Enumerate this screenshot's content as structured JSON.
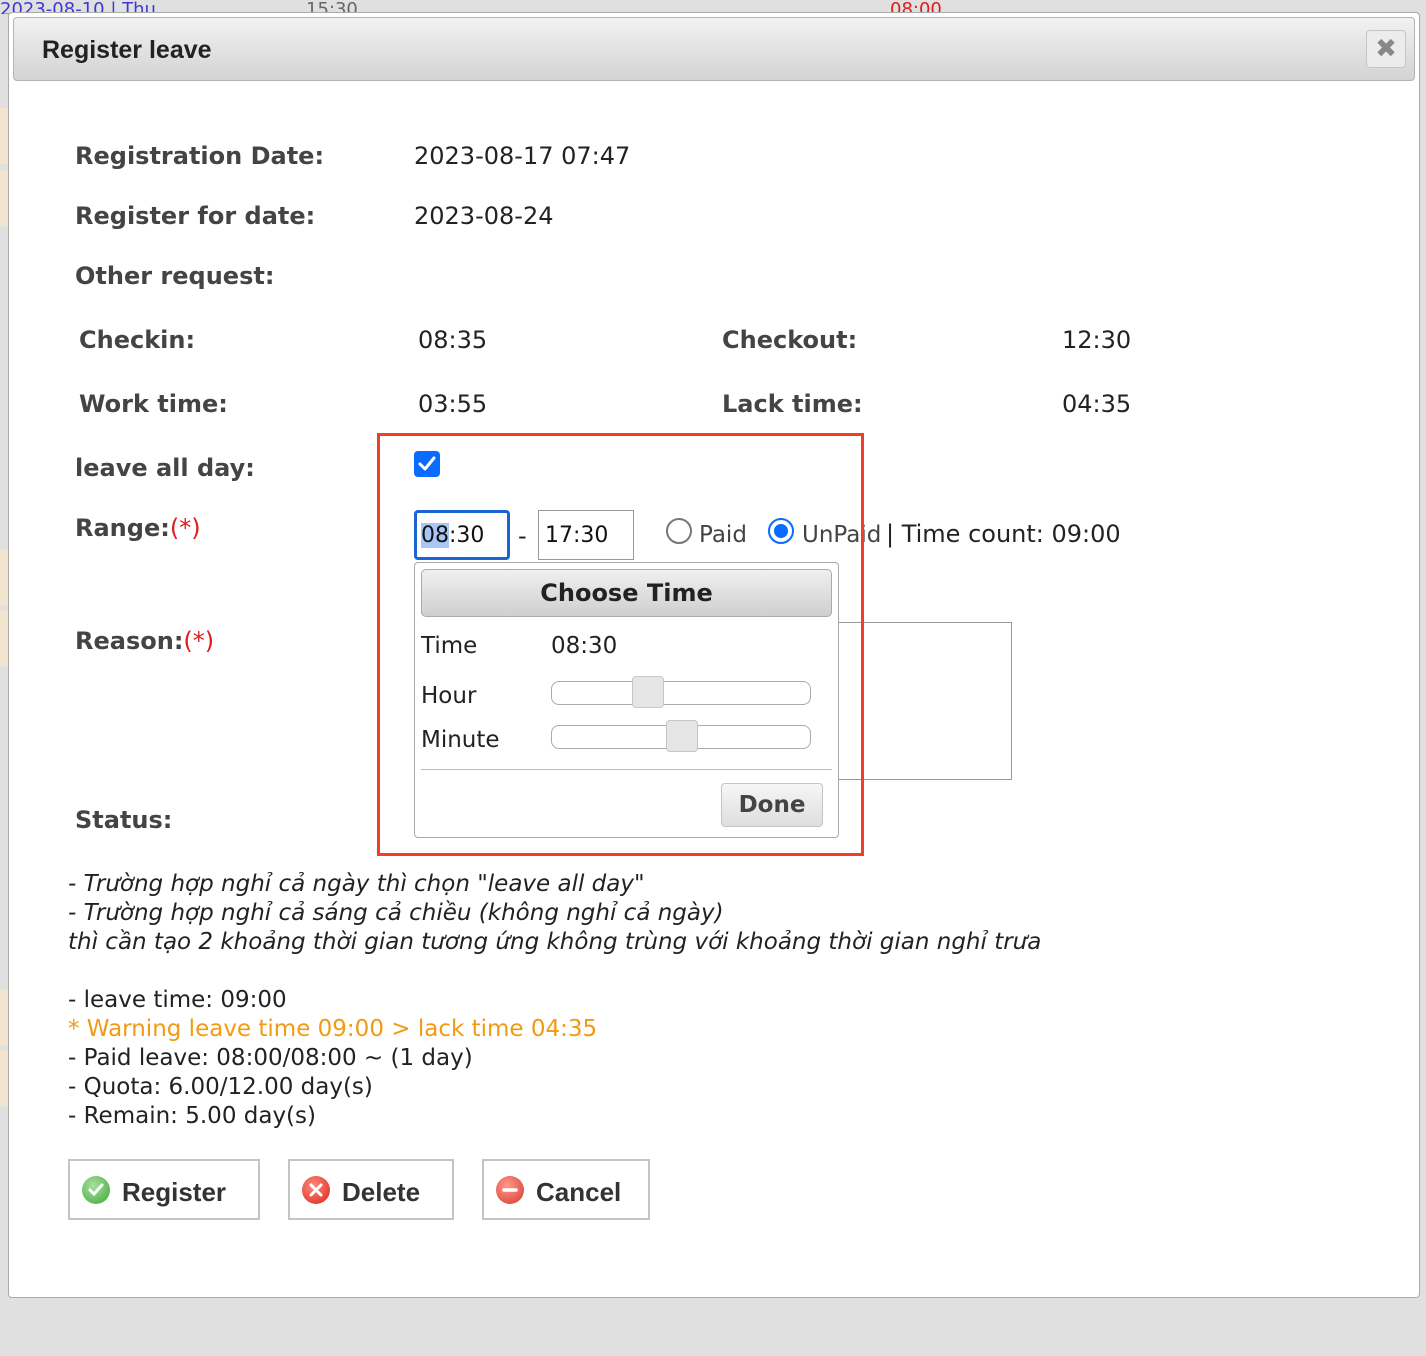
{
  "background": {
    "top_fragments": [
      "2023-08-10 | Thu",
      "15:30",
      "08:00"
    ]
  },
  "dialog": {
    "title": "Register leave",
    "close_icon": "close-x-icon"
  },
  "form": {
    "registration_date_label": "Registration Date:",
    "registration_date_value": "2023-08-17 07:47",
    "register_for_label": "Register for date:",
    "register_for_value": "2023-08-24",
    "other_request_label": "Other request:",
    "checkin_label": "Checkin:",
    "checkin_value": "08:35",
    "checkout_label": "Checkout:",
    "checkout_value": "12:30",
    "work_time_label": "Work time:",
    "work_time_value": "03:55",
    "lack_time_label": "Lack time:",
    "lack_time_value": "04:35",
    "leave_all_day_label": "leave all day:",
    "leave_all_day_checked": true,
    "range_label": "Range:",
    "required_mark": "(*)",
    "range_from": "08:30",
    "range_from_selected": "08",
    "range_from_rest": ":30",
    "range_separator": "-",
    "range_to": "17:30",
    "paid_label": "Paid",
    "unpaid_label": "UnPaid",
    "paid_selected": false,
    "unpaid_selected": true,
    "time_count_text": "| Time count: 09:00",
    "reason_label": "Reason:",
    "status_label": "Status:"
  },
  "time_picker": {
    "header": "Choose Time",
    "time_label": "Time",
    "time_value": "08:30",
    "hour_label": "Hour",
    "minute_label": "Minute",
    "hour_fraction": 0.35,
    "minute_fraction": 0.5,
    "done_label": "Done"
  },
  "notes": {
    "line1": "- Trường hợp nghỉ cả ngày thì chọn \"leave all day\"",
    "line2": "- Trường hợp nghỉ cả sáng cả chiều (không nghỉ cả ngày)",
    "line3": "thì cần tạo 2 khoảng thời gian tương ứng không trùng với khoảng thời gian nghỉ trưa",
    "leave_time": "- leave time: 09:00",
    "warning": "* Warning leave time 09:00 > lack time 04:35",
    "paid_leave": "- Paid leave: 08:00/08:00 ~ (1 day)",
    "quota": "- Quota: 6.00/12.00 day(s)",
    "remain": "- Remain: 5.00 day(s)"
  },
  "buttons": {
    "register": "Register",
    "delete": "Delete",
    "cancel": "Cancel"
  },
  "colors": {
    "accent_blue": "#0a6cff",
    "required_red": "#e21a1a",
    "warning_orange": "#f29a12",
    "highlight_red": "#ef4027"
  }
}
